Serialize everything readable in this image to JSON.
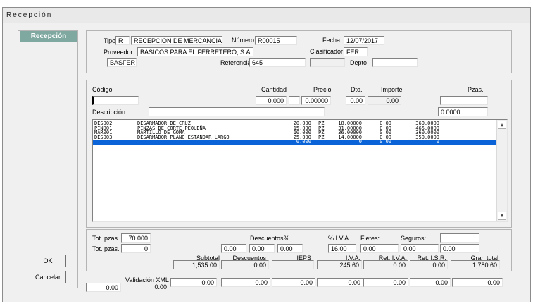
{
  "window": {
    "title": "Recepción"
  },
  "sidebar": {
    "tab_label": "Recepción",
    "ok_label": "OK",
    "cancel_label": "Cancelar"
  },
  "header": {
    "tipo_label": "Tipo",
    "tipo_value": "R",
    "tipo_desc": "RECEPCION DE MERCANCIA",
    "numero_label": "Número",
    "numero_value": "R00015",
    "fecha_label": "Fecha",
    "fecha_value": "12/07/2017",
    "proveedor_label": "Proveedor",
    "proveedor_value": "BASICOS PARA EL FERRETERO, S.A.",
    "clasificador_label": "Clasificador",
    "clasificador_value": "FER",
    "codigo_prov_value": "BASFER",
    "referencia_label": "Referencia",
    "referencia_value": "645",
    "depto_label": "Depto",
    "depto_value": ""
  },
  "entry": {
    "codigo_label": "Código",
    "cantidad_label": "Cantidad",
    "precio_label": "Precio",
    "dto_label": "Dto.",
    "importe_label": "Importe",
    "pzas_label": "Pzas.",
    "codigo_value": "",
    "cantidad_value": "0.000",
    "precio_value": "0.00000",
    "dto_value": "0.00",
    "importe_value": "0.00",
    "pzas_value": "",
    "descripcion_label": "Descripción",
    "descripcion_value": "",
    "extra_value": "0.0000"
  },
  "items": [
    {
      "codigo": "DES002",
      "descripcion": "DESARMADOR DE CRUZ",
      "cantidad": "20.000",
      "unidad": "PZ",
      "precio": "18.00000",
      "dto": "0.00",
      "importe": "360.0000"
    },
    {
      "codigo": "PIN001",
      "descripcion": "PINZAS DE CORTE PEQUEÑA",
      "cantidad": "15.000",
      "unidad": "PZ",
      "precio": "31.00000",
      "dto": "0.00",
      "importe": "465.0000"
    },
    {
      "codigo": "MAR001",
      "descripcion": "MARTILLO DE GOMA",
      "cantidad": "10.000",
      "unidad": "PZ",
      "precio": "36.00000",
      "dto": "0.00",
      "importe": "360.0000"
    },
    {
      "codigo": "DES003",
      "descripcion": "DESARMADOR PLANO ESTANDAR LARGO",
      "cantidad": "25.000",
      "unidad": "PZ",
      "precio": "14.00000",
      "dto": "0.00",
      "importe": "350.0000"
    }
  ],
  "blank_row": {
    "cantidad": "0.000",
    "precio": "0",
    "dto": "0.00",
    "importe": "0"
  },
  "totals": {
    "tot_pzas_label": "Tot. pzas.",
    "tot_pzas_value": "70.000",
    "tot_pzas2_label": "Tot. pzas.",
    "tot_pzas2_value": "0",
    "descuentos_label": "Descuentos",
    "pct_label": "%",
    "desc1": "0.00",
    "desc2": "0.00",
    "desc3": "0.00",
    "iva_pct_label": "% I.V.A.",
    "iva_pct_value": "16.00",
    "fletes_label": "Fletes:",
    "fletes_value": "0.00",
    "seguros_label": "Seguros:",
    "seguros_value": "0.00",
    "blank_top": "",
    "extra_value": "0.00",
    "subtotal_label": "Subtotal",
    "subtotal_value": "1,535.00",
    "descuentos2_label": "Descuentos",
    "descuentos2_value": "0.00",
    "ieps_label": "IEPS",
    "ieps_value": "",
    "iva_label": "I.V.A.",
    "iva_value": "245.60",
    "ret_iva_label": "Ret. I.V.A.",
    "ret_iva_value": "0.00",
    "ret_isr_label": "Ret. I.S.R.",
    "ret_isr_value": "0.00",
    "gran_total_label": "Gran total",
    "gran_total_value": "1,780.60"
  },
  "validacion": {
    "label": "Validación XML",
    "v0": "0.00",
    "v1": "0.00",
    "v2": "0.00",
    "v3": "0.00",
    "v4": "0.00",
    "v5": "0.00",
    "v6": "0.00",
    "v7": "0.00",
    "v8": "0.00"
  }
}
